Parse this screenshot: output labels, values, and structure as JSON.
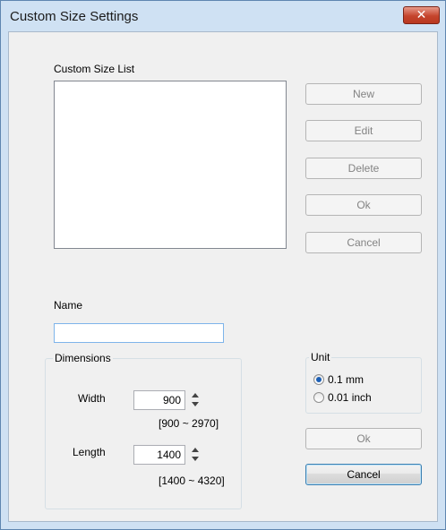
{
  "window": {
    "title": "Custom Size Settings",
    "close_glyph": "✕"
  },
  "list": {
    "label": "Custom Size List",
    "items": []
  },
  "list_buttons": {
    "new": "New",
    "edit": "Edit",
    "delete": "Delete",
    "ok": "Ok",
    "cancel": "Cancel"
  },
  "name": {
    "label": "Name",
    "value": ""
  },
  "dimensions": {
    "label": "Dimensions",
    "width": {
      "label": "Width",
      "value": "900",
      "range": "[900 ~ 2970]"
    },
    "length": {
      "label": "Length",
      "value": "1400",
      "range": "[1400 ~ 4320]"
    }
  },
  "unit": {
    "label": "Unit",
    "options": [
      {
        "label": "0.1 mm",
        "selected": true
      },
      {
        "label": "0.01 inch",
        "selected": false
      }
    ]
  },
  "footer": {
    "ok": "Ok",
    "cancel": "Cancel"
  },
  "colors": {
    "title_bar": "#cfe1f3",
    "close_button": "#c5452d",
    "dialog_bg": "#f0f0f0",
    "focus_border": "#3c7fb1"
  }
}
